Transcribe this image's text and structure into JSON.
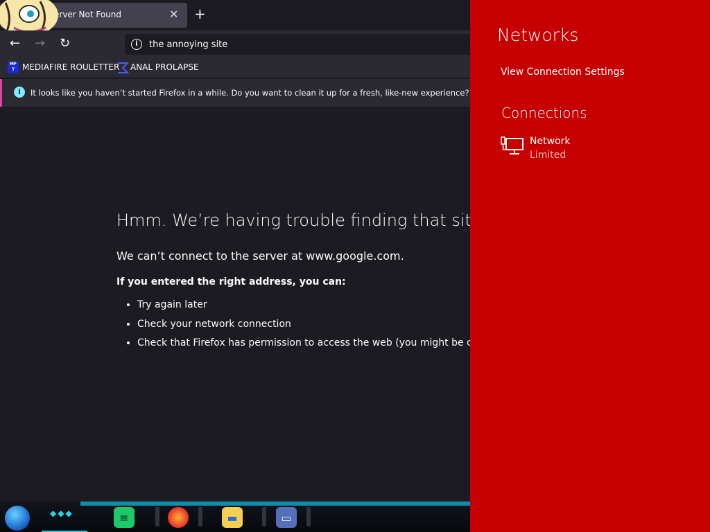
{
  "browser": {
    "tab_title": "erver Not Found",
    "tab_close": "✕",
    "new_tab": "+",
    "url": "the annoying site",
    "nav": {
      "back": "←",
      "forward": "→",
      "reload": "↻"
    },
    "bookmarks": [
      {
        "label": "MEDIAFIRE ROULETTER",
        "icon_text": "MF T"
      },
      {
        "label": "ANAL PROLAPSE"
      }
    ],
    "notification": "It looks like you haven’t started Firefox in a while. Do you want to clean it up for a fresh, like-new experience? And by the"
  },
  "error_page": {
    "title": "Hmm. We’re having trouble finding that site.",
    "subtitle": "We can’t connect to the server at www.google.com.",
    "advice_heading": "If you entered the right address, you can:",
    "advice": [
      "Try again later",
      "Check your network connection",
      "Check that Firefox has permission to access the web (you might be conne"
    ]
  },
  "flyout": {
    "title": "Networks",
    "settings_link": "View Connection Settings",
    "section": "Connections",
    "network": {
      "name": "Network",
      "status": "Limited"
    }
  },
  "colors": {
    "flyout_bg": "#c60000",
    "page_bg": "#1c1b22",
    "chrome_bg": "#2b2a33",
    "notification_accent": "#d946a6"
  }
}
